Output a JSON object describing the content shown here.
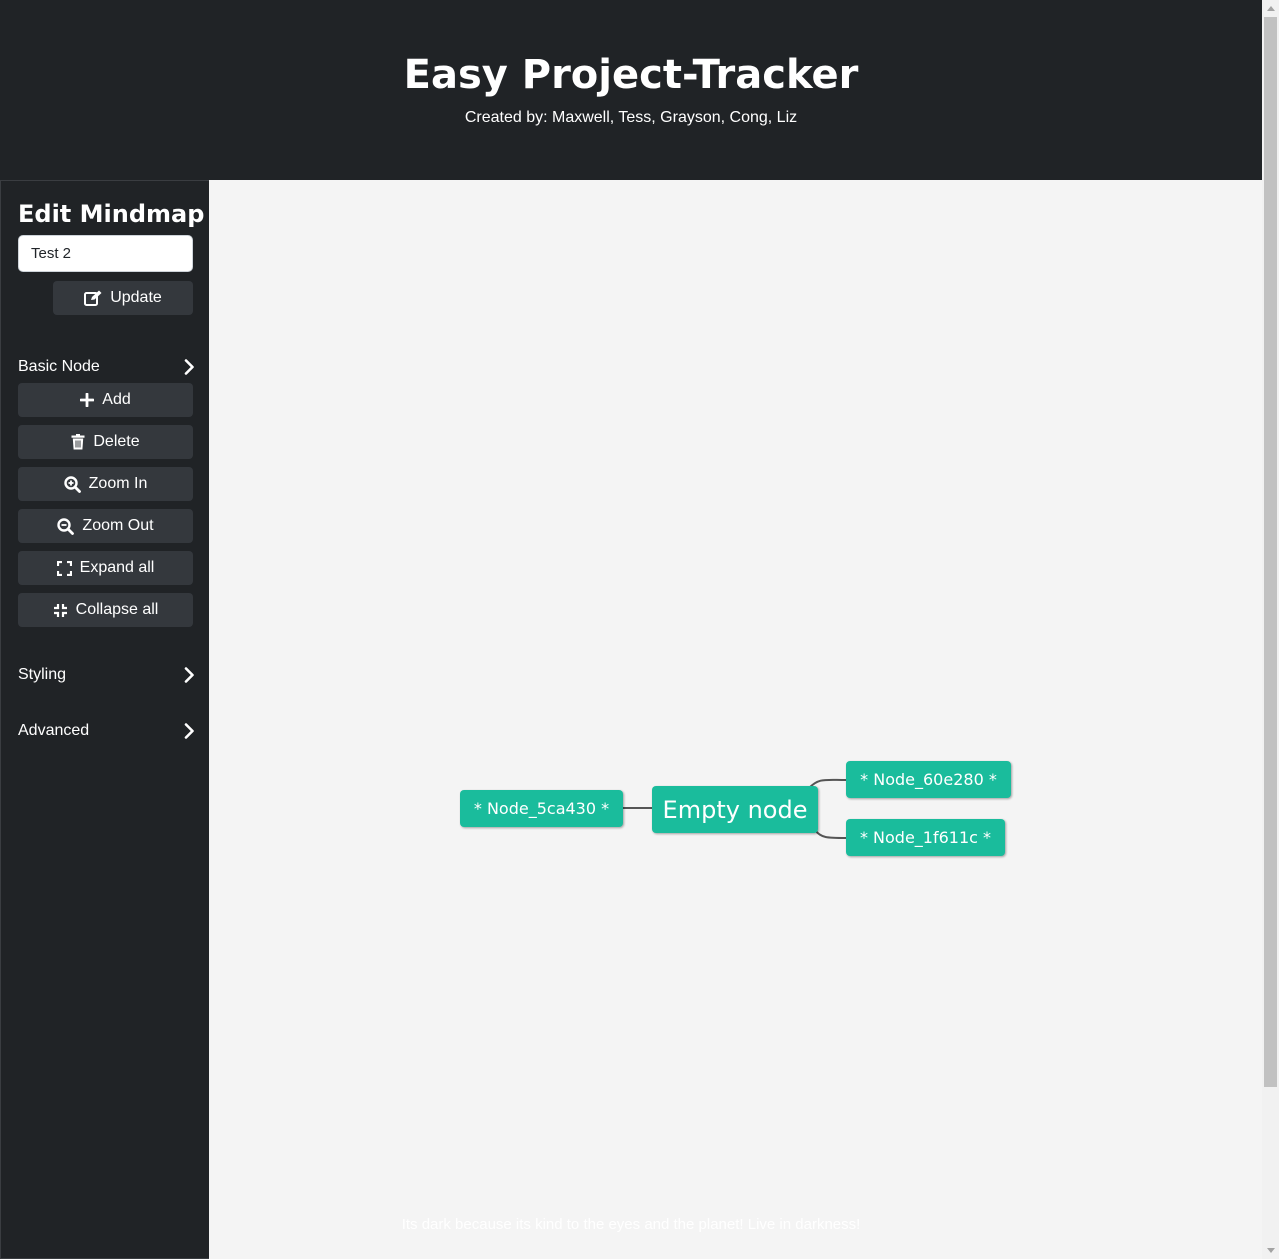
{
  "header": {
    "title": "Easy Project-Tracker",
    "credits": "Created by: Maxwell, Tess, Grayson, Cong, Liz"
  },
  "sidebar": {
    "title": "Edit Mindmap",
    "name_input_value": "Test 2",
    "update_label": "Update",
    "basic_node_label": "Basic Node",
    "buttons": {
      "add": "Add",
      "delete": "Delete",
      "zoom_in": "Zoom In",
      "zoom_out": "Zoom Out",
      "expand_all": "Expand all",
      "collapse_all": "Collapse all"
    },
    "styling_label": "Styling",
    "advanced_label": "Advanced"
  },
  "mindmap": {
    "root": "Empty node",
    "left_child": "* Node_5ca430 *",
    "right_child_top": "* Node_60e280 *",
    "right_child_bottom": "* Node_1f611c *",
    "node_color": "#1abc9c",
    "line_color": "#555555"
  },
  "footer": {
    "text": "Its dark because its kind to the eyes and the planet! Live in darkness!"
  },
  "colors": {
    "dark_bg": "#202326",
    "button_bg": "#34383d",
    "canvas_bg": "#f4f4f4"
  }
}
